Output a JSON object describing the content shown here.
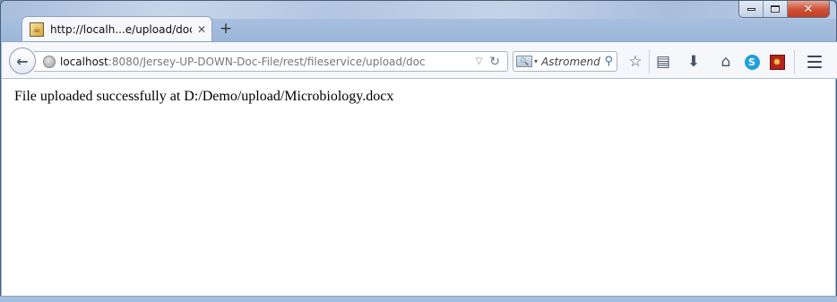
{
  "window": {
    "caption_buttons": {
      "minimize": "minimize",
      "maximize": "maximize",
      "close": "close"
    }
  },
  "tab": {
    "title": "http://localh...e/upload/doc",
    "close_glyph": "✕",
    "favicon": "java-duke-icon"
  },
  "new_tab": {
    "label": "+"
  },
  "toolbar": {
    "url": {
      "host": "localhost",
      "path": ":8080/Jersey-UP-DOWN-Doc-File/rest/fileservice/upload/doc"
    },
    "search": {
      "placeholder": "Astromend"
    },
    "icons": [
      "back-icon",
      "globe-icon",
      "dropdown-icon",
      "reload-icon",
      "search-engine-icon",
      "magnifier-icon",
      "bookmark-star-icon",
      "reading-list-icon",
      "download-icon",
      "home-icon",
      "skype-icon",
      "addon-icon",
      "menu-icon"
    ]
  },
  "page": {
    "message": "File uploaded successfully at D:/Demo/upload/Microbiology.docx"
  }
}
